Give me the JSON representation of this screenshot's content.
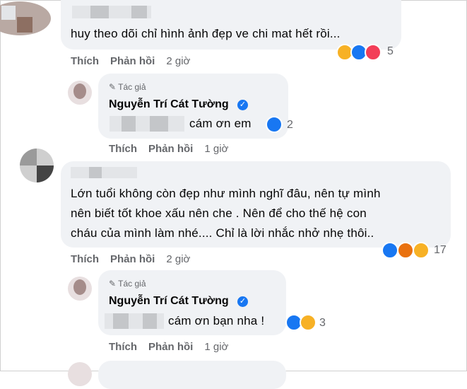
{
  "comments": [
    {
      "text": "huy theo dõi chỉ hình ảnh đẹp ve chi mat hết rồi...",
      "actions": {
        "like": "Thích",
        "reply": "Phản hồi",
        "time": "2 giờ"
      },
      "reactions": {
        "icons": [
          "haha-icon",
          "like-icon",
          "love-icon"
        ],
        "count": "5"
      }
    },
    {
      "author_tag": "Tác giả",
      "author_name": "Nguyễn Trí Cát Tường",
      "text": "cám ơn em",
      "actions": {
        "like": "Thích",
        "reply": "Phản hồi",
        "time": "1 giờ"
      },
      "reactions": {
        "icons": [
          "like-icon"
        ],
        "count": "2"
      }
    },
    {
      "lines": [
        "Lớn tuổi không còn đẹp như mình nghĩ đâu, nên tự mình",
        "nên biết tốt khoe xấu nên che . Nên để cho thế hệ con",
        "cháu của mình làm nhé.... Chỉ là lời nhắc nhở nhẹ thôi.."
      ],
      "actions": {
        "like": "Thích",
        "reply": "Phản hồi",
        "time": "2 giờ"
      },
      "reactions": {
        "icons": [
          "like-icon",
          "angry-icon",
          "care-icon"
        ],
        "count": "17"
      }
    },
    {
      "author_tag": "Tác giả",
      "author_name": "Nguyễn Trí Cát Tường",
      "text": "cám ơn bạn nha !",
      "actions": {
        "like": "Thích",
        "reply": "Phản hồi",
        "time": "1 giờ"
      },
      "reactions": {
        "icons": [
          "like-icon",
          "care-icon"
        ],
        "count": "3"
      }
    }
  ],
  "colors": {
    "bubble": "#f0f2f5",
    "meta": "#65676b",
    "like": "#1877f2"
  }
}
